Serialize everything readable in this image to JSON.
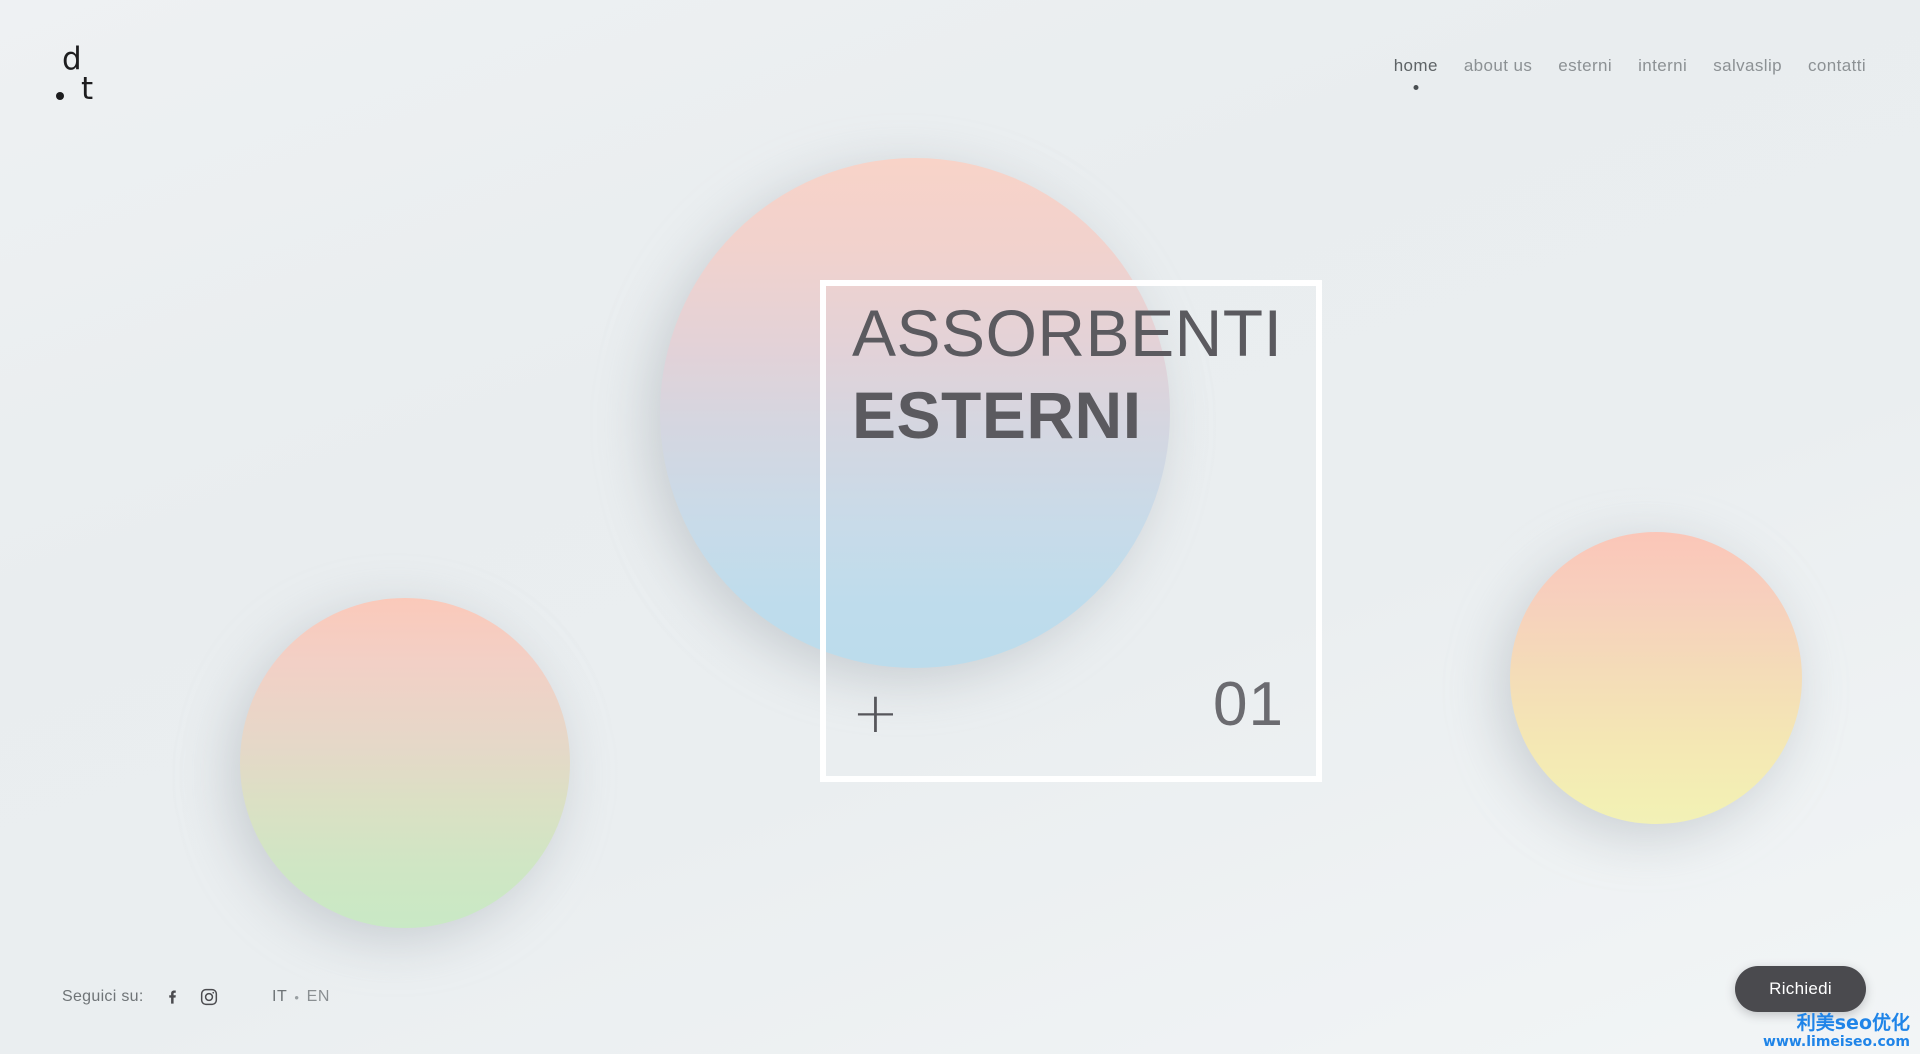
{
  "brand": {
    "logo_top": "d",
    "logo_bottom": "t",
    "logo_dot": "•"
  },
  "nav": {
    "items": [
      {
        "label": "home",
        "active": true
      },
      {
        "label": "about us",
        "active": false
      },
      {
        "label": "esterni",
        "active": false
      },
      {
        "label": "interni",
        "active": false
      },
      {
        "label": "salvaslip",
        "active": false
      },
      {
        "label": "contatti",
        "active": false
      }
    ]
  },
  "hero": {
    "title_line1": "ASSORBENTI",
    "title_line2": "ESTERNI",
    "expand_symbol": "+",
    "slide_index": "01"
  },
  "decor": {
    "orbs": [
      {
        "name": "center-orb",
        "gradient_from": "#f8d3c8",
        "gradient_to": "#bcdcec"
      },
      {
        "name": "left-orb",
        "gradient_from": "#fbc9ba",
        "gradient_to": "#c9e9c5"
      },
      {
        "name": "right-orb",
        "gradient_from": "#fbc6b8",
        "gradient_to": "#f2f1b6"
      }
    ],
    "frame_color": "#ffffff"
  },
  "footer": {
    "social_label": "Seguici su:",
    "social_icons": [
      {
        "name": "facebook-icon",
        "label": "Facebook"
      },
      {
        "name": "instagram-icon",
        "label": "Instagram"
      }
    ],
    "languages": [
      {
        "code": "IT",
        "active": true
      },
      {
        "code": "EN",
        "active": false
      }
    ],
    "lang_separator": "•",
    "cta_label": "Richiedi"
  },
  "watermark": {
    "cn_text": "利美seo优化",
    "url_text": "www.limeiseo.com",
    "color": "#1f84e8"
  },
  "theme": {
    "background_from": "#eef1f3",
    "background_to": "#f2f5f6",
    "text_primary": "#5b5a5f",
    "text_muted": "#8c9194",
    "cta_bg": "#4a4a4e"
  }
}
